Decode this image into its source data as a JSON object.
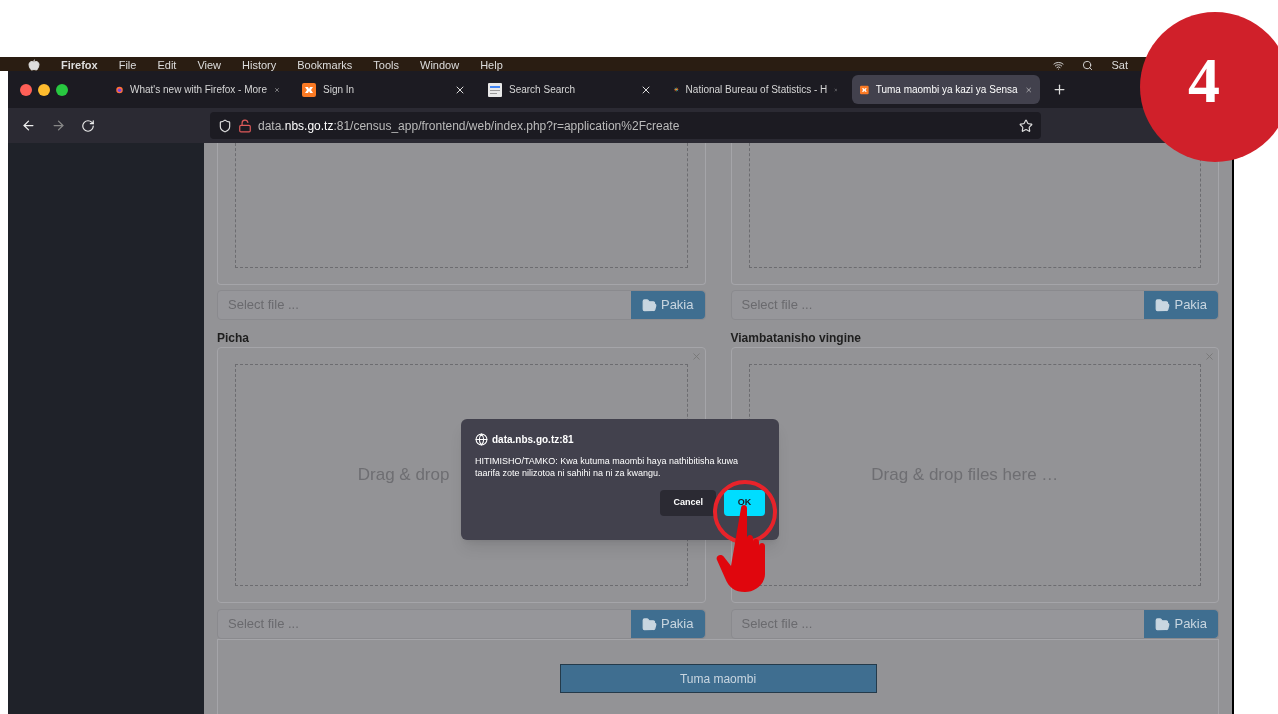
{
  "menu_bar": {
    "items": [
      "Firefox",
      "File",
      "Edit",
      "View",
      "History",
      "Bookmarks",
      "Tools",
      "Window",
      "Help"
    ],
    "clock": "Sat"
  },
  "tabs": [
    {
      "title": "What's new with Firefox - More",
      "kind": "firefox",
      "selected": false
    },
    {
      "title": "Sign In",
      "kind": "orange",
      "selected": false
    },
    {
      "title": "Search Search",
      "kind": "google",
      "selected": false
    },
    {
      "title": "National Bureau of Statistics - H",
      "kind": "joomla",
      "selected": false
    },
    {
      "title": "Tuma maombi ya kazi ya Sensa",
      "kind": "orange",
      "selected": true
    }
  ],
  "url": "data.**nbs.go.tz**:81/census_app/frontend/web/index.php?r=application%2Fcreate",
  "upper_uploads": [
    {
      "placeholder": "Select file ...",
      "button": "Pakia"
    },
    {
      "placeholder": "Select file ...",
      "button": "Pakia"
    }
  ],
  "sections": [
    {
      "label": "Picha",
      "drop_text": "Drag & drop",
      "placeholder": "Select file ...",
      "button": "Pakia"
    },
    {
      "label": "Viambatanisho vingine",
      "drop_text": "Drag & drop files here …",
      "placeholder": "Select file ...",
      "button": "Pakia"
    }
  ],
  "submit": "Tuma maombi",
  "dialog": {
    "origin": "data.nbs.go.tz:81",
    "message": "HITIMISHO/TAMKO: Kwa kutuma maombi haya nathibitisha kuwa taarifa zote nilizotoa ni sahihi na ni za kwangu.",
    "buttons": [
      {
        "label": "Cancel",
        "primary": false
      },
      {
        "label": "OK",
        "primary": true
      }
    ]
  },
  "step_badge": "4"
}
